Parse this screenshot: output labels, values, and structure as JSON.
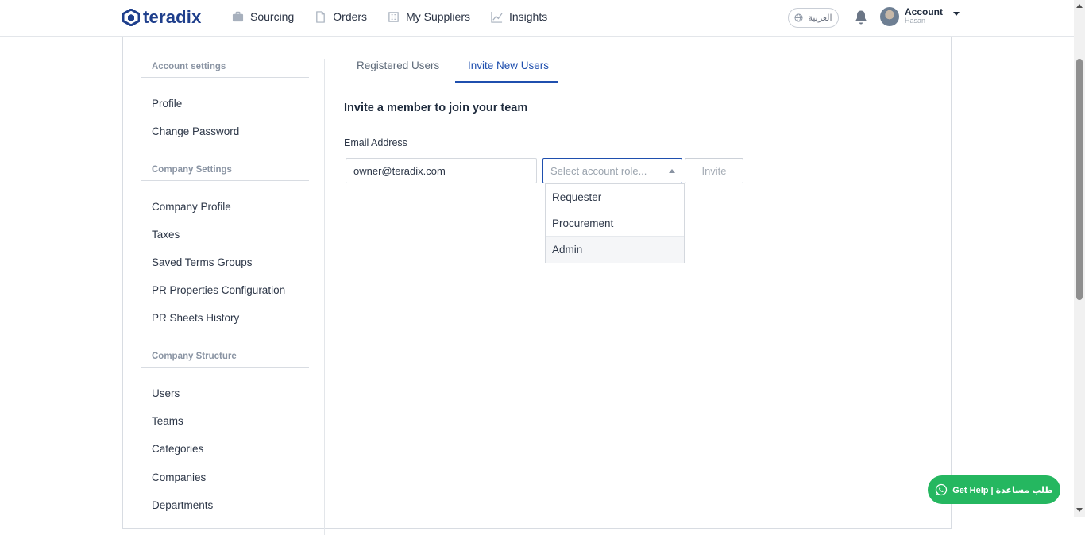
{
  "brand": {
    "name": "teradix",
    "color": "#1f3f8c"
  },
  "nav": [
    {
      "label": "Sourcing",
      "icon": "briefcase-icon"
    },
    {
      "label": "Orders",
      "icon": "document-icon"
    },
    {
      "label": "My Suppliers",
      "icon": "building-icon"
    },
    {
      "label": "Insights",
      "icon": "chart-line-icon"
    }
  ],
  "header": {
    "language_label": "العربية",
    "account_label": "Account",
    "account_user": "Hasan"
  },
  "sidebar": {
    "sections": [
      {
        "title": "Account settings",
        "items": [
          "Profile",
          "Change Password"
        ]
      },
      {
        "title": "Company Settings",
        "items": [
          "Company Profile",
          "Taxes",
          "Saved Terms Groups",
          "PR Properties Configuration",
          "PR Sheets History"
        ]
      },
      {
        "title": "Company Structure",
        "items": [
          "Users",
          "Teams",
          "Categories",
          "Companies",
          "Departments"
        ]
      }
    ]
  },
  "tabs": [
    {
      "label": "Registered Users",
      "active": false
    },
    {
      "label": "Invite New Users",
      "active": true
    }
  ],
  "form": {
    "title": "Invite a member to join your team",
    "email_label": "Email Address",
    "email_value": "owner@teradix.com",
    "role_placeholder": "Select account role...",
    "invite_label": "Invite",
    "role_options": [
      "Requester",
      "Procurement",
      "Admin"
    ]
  },
  "help_button": {
    "label": "Get Help | طلب مساعدة",
    "icon": "whatsapp-icon",
    "color": "#25b760"
  },
  "accent_color": "#1f4fae"
}
